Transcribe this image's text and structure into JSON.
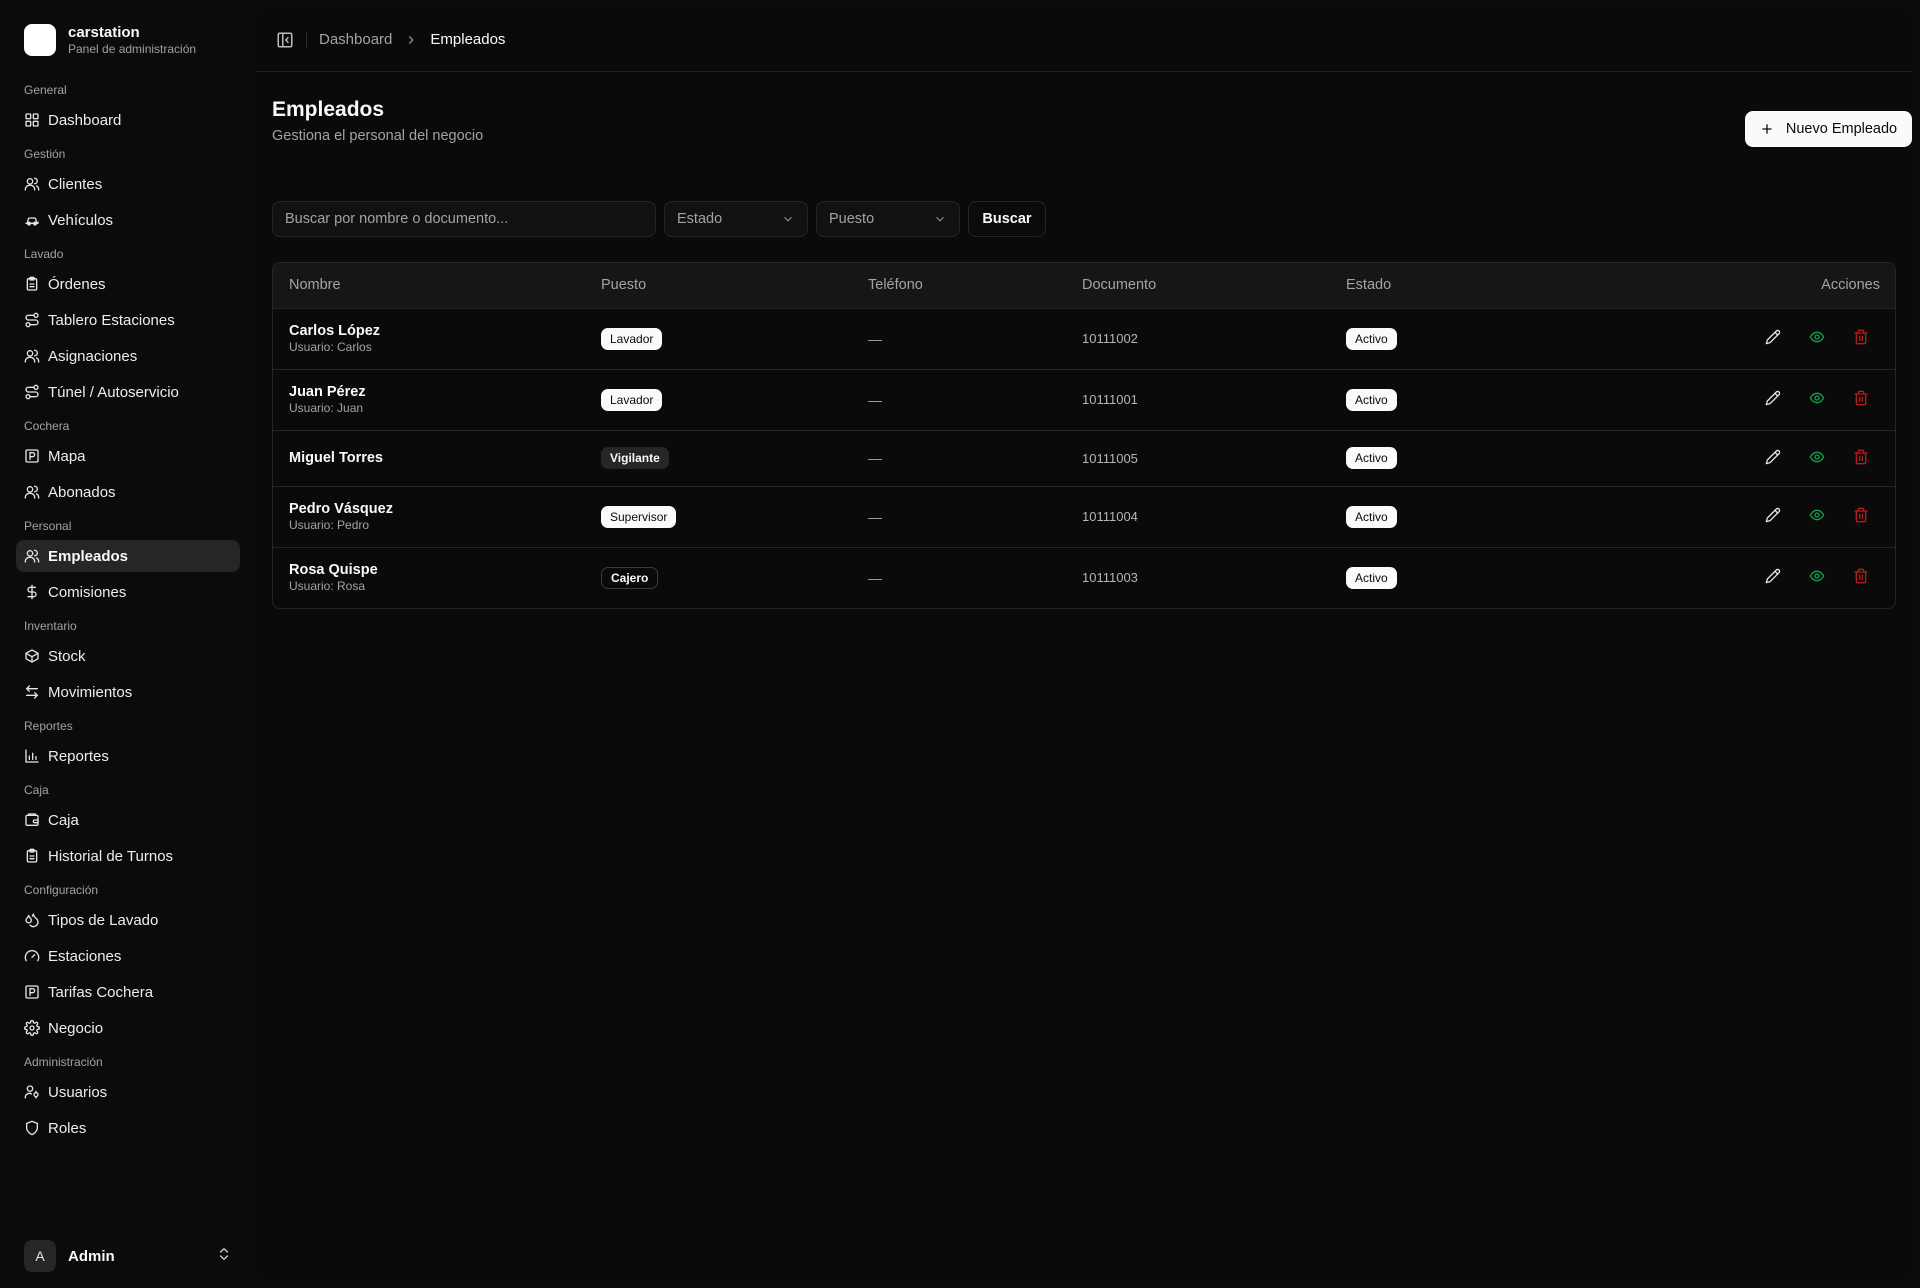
{
  "brand": {
    "title": "carstation",
    "subtitle": "Panel de administración"
  },
  "sidebar": {
    "groups": [
      {
        "label": "General",
        "items": [
          {
            "label": "Dashboard",
            "icon": "layout-grid-icon"
          }
        ]
      },
      {
        "label": "Gestión",
        "items": [
          {
            "label": "Clientes",
            "icon": "users-icon"
          },
          {
            "label": "Vehículos",
            "icon": "car-icon"
          }
        ]
      },
      {
        "label": "Lavado",
        "items": [
          {
            "label": "Órdenes",
            "icon": "clipboard-icon"
          },
          {
            "label": "Tablero Estaciones",
            "icon": "route-icon"
          },
          {
            "label": "Asignaciones",
            "icon": "users-icon"
          },
          {
            "label": "Túnel / Autoservicio",
            "icon": "route-icon"
          }
        ]
      },
      {
        "label": "Cochera",
        "items": [
          {
            "label": "Mapa",
            "icon": "parking-icon"
          },
          {
            "label": "Abonados",
            "icon": "users-icon"
          }
        ]
      },
      {
        "label": "Personal",
        "items": [
          {
            "label": "Empleados",
            "icon": "users-icon",
            "active": true
          },
          {
            "label": "Comisiones",
            "icon": "dollar-icon"
          }
        ]
      },
      {
        "label": "Inventario",
        "items": [
          {
            "label": "Stock",
            "icon": "package-icon"
          },
          {
            "label": "Movimientos",
            "icon": "arrows-icon"
          }
        ]
      },
      {
        "label": "Reportes",
        "items": [
          {
            "label": "Reportes",
            "icon": "bar-chart-icon"
          }
        ]
      },
      {
        "label": "Caja",
        "items": [
          {
            "label": "Caja",
            "icon": "wallet-icon"
          },
          {
            "label": "Historial de Turnos",
            "icon": "clipboard-icon"
          }
        ]
      },
      {
        "label": "Configuración",
        "items": [
          {
            "label": "Tipos de Lavado",
            "icon": "droplets-icon"
          },
          {
            "label": "Estaciones",
            "icon": "gauge-icon"
          },
          {
            "label": "Tarifas Cochera",
            "icon": "parking-icon"
          },
          {
            "label": "Negocio",
            "icon": "gear-icon"
          }
        ]
      },
      {
        "label": "Administración",
        "items": [
          {
            "label": "Usuarios",
            "icon": "user-cog-icon"
          },
          {
            "label": "Roles",
            "icon": "shield-icon"
          }
        ]
      }
    ]
  },
  "user": {
    "initial": "A",
    "name": "Admin"
  },
  "breadcrumb": {
    "parent": "Dashboard",
    "current": "Empleados"
  },
  "page": {
    "title": "Empleados",
    "subtitle": "Gestiona el personal del negocio",
    "new_button": "Nuevo Empleado"
  },
  "filters": {
    "search_placeholder": "Buscar por nombre o documento...",
    "estado": "Estado",
    "puesto": "Puesto",
    "search_button": "Buscar"
  },
  "table": {
    "headers": {
      "nombre": "Nombre",
      "puesto": "Puesto",
      "telefono": "Teléfono",
      "documento": "Documento",
      "estado": "Estado",
      "acciones": "Acciones"
    },
    "rows": [
      {
        "name": "Carlos López",
        "user": "Usuario: Carlos",
        "role": "Lavador",
        "role_style": "light",
        "phone": "—",
        "doc": "10111002",
        "status": "Activo"
      },
      {
        "name": "Juan Pérez",
        "user": "Usuario: Juan",
        "role": "Lavador",
        "role_style": "light",
        "phone": "—",
        "doc": "10111001",
        "status": "Activo"
      },
      {
        "name": "Miguel Torres",
        "user": "",
        "role": "Vigilante",
        "role_style": "dark",
        "phone": "—",
        "doc": "10111005",
        "status": "Activo"
      },
      {
        "name": "Pedro Vásquez",
        "user": "Usuario: Pedro",
        "role": "Supervisor",
        "role_style": "light",
        "phone": "—",
        "doc": "10111004",
        "status": "Activo"
      },
      {
        "name": "Rosa Quispe",
        "user": "Usuario: Rosa",
        "role": "Cajero",
        "role_style": "outline",
        "phone": "—",
        "doc": "10111003",
        "status": "Activo"
      }
    ]
  },
  "colors": {
    "background": "#0b0b0b",
    "panel": "#0a0a0a",
    "accent": "#fafafa",
    "view_icon": "#16a34a",
    "delete_icon": "#b91c1c"
  }
}
